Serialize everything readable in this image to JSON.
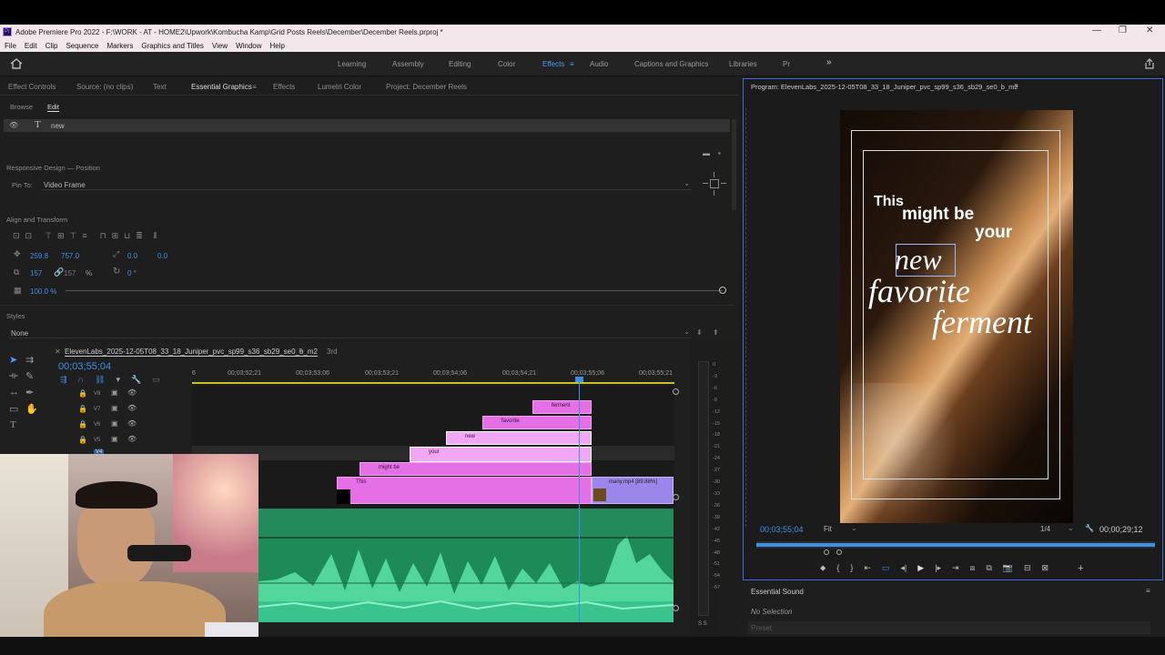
{
  "window": {
    "title": "Adobe Premiere Pro 2022 - F:\\WORK - AT - HOME2\\Upwork\\Kombucha Kamp\\Grid Posts Reels\\December\\December Reels.prproj *",
    "app_icon": "Pr",
    "min": "—",
    "max": "❐",
    "close": "✕"
  },
  "menu": [
    "File",
    "Edit",
    "Clip",
    "Sequence",
    "Markers",
    "Graphics and Titles",
    "View",
    "Window",
    "Help"
  ],
  "workspaces": [
    "Learning",
    "Assembly",
    "Editing",
    "Color",
    "Effects",
    "Audio",
    "Captions and Graphics",
    "Libraries",
    "Pr"
  ],
  "workspace_active": "Effects",
  "workspace_more": "»",
  "left_tabs": [
    "Effect Controls",
    "Source: (no clips)",
    "Text",
    "Essential Graphics",
    "Effects",
    "Lumetri Color",
    "Project: December Reels"
  ],
  "eg": {
    "subtabs": [
      "Browse",
      "Edit"
    ],
    "layer_name": "new",
    "responsive_title": "Responsive Design — Position",
    "pin_to_label": "Pin To:",
    "pin_to_value": "Video Frame",
    "align_title": "Align and Transform",
    "pos_x": "259.8",
    "pos_y": "757.0",
    "anchor_x": "0.0",
    "anchor_y": "0.0",
    "scale": "157",
    "scale_h": "157",
    "pct": "%",
    "rotation": "0 °",
    "opacity": "100.0 %",
    "styles_title": "Styles",
    "styles_value": "None"
  },
  "sequence": {
    "tab1": "ElevenLabs_2025-12-05T08_33_18_Juniper_pvc_sp99_s36_sb29_se0_b_m2",
    "tab2": "3rd",
    "timecode": "00;03;55;04",
    "ruler": [
      "6",
      "00;03;52;21",
      "00;03;53;06",
      "00;03;53;21",
      "00;03;54;06",
      "00;03;54;21",
      "00;03;55;06",
      "00;03;55;21"
    ],
    "tracks": [
      "V8",
      "V7",
      "V6",
      "V5",
      "V4"
    ],
    "clips": [
      "ferment",
      "favorite",
      "new",
      "your",
      "might be",
      "This"
    ],
    "video_clip": "many.mp4 [89.88%]",
    "meter_ticks": [
      "0",
      "-3",
      "-6",
      "-9",
      "-12",
      "-15",
      "-18",
      "-21",
      "-24",
      "-27",
      "-30",
      "-33",
      "-36",
      "-39",
      "-42",
      "-45",
      "-48",
      "-51",
      "-54",
      "-57"
    ],
    "meter_s": "S S"
  },
  "program": {
    "title": "Program: ElevenLabs_2025-12-05T08_33_18_Juniper_pvc_sp99_s36_sb29_se0_b_m2",
    "timecode": "00;03;55;04",
    "fit": "Fit",
    "quality": "1/4",
    "duration": "00;00;29;12",
    "overlay": [
      "This",
      "might be",
      "your",
      "new",
      "favorite",
      "ferment"
    ]
  },
  "essential_sound": {
    "title": "Essential Sound",
    "selection": "No Selection",
    "preset": "Preset"
  }
}
